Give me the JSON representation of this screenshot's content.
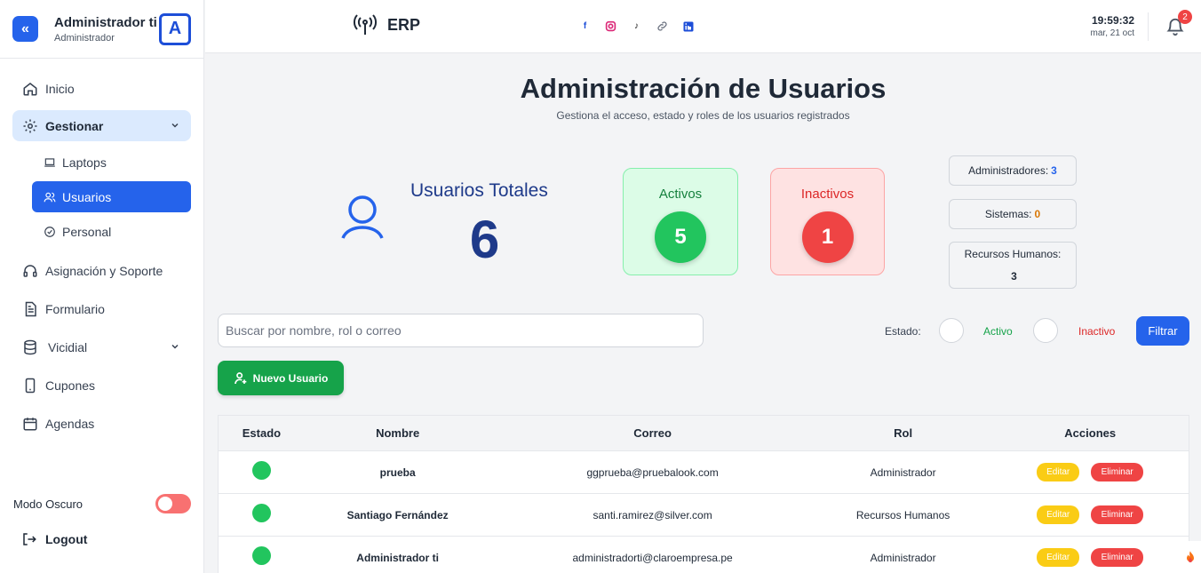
{
  "sidebar": {
    "user_name": "Administrador ti",
    "user_role": "Administrador",
    "avatar_letter": "A",
    "items": [
      {
        "label": "Inicio",
        "icon": "home-icon"
      },
      {
        "label": "Gestionar",
        "icon": "gear-icon"
      },
      {
        "label": "Asignación y Soporte",
        "icon": "headset-icon"
      },
      {
        "label": "Formulario",
        "icon": "document-icon"
      },
      {
        "label": "Vicidial",
        "icon": "database-icon"
      },
      {
        "label": "Cupones",
        "icon": "phone-icon"
      },
      {
        "label": "Agendas",
        "icon": "calendar-icon"
      }
    ],
    "sub_items": [
      {
        "label": "Laptops",
        "icon": "laptop-icon"
      },
      {
        "label": "Usuarios",
        "icon": "users-icon"
      },
      {
        "label": "Personal",
        "icon": "check-circle-icon"
      }
    ],
    "dark_mode_label": "Modo Oscuro",
    "logout_label": "Logout"
  },
  "topbar": {
    "brand": "ERP",
    "time": "19:59:32",
    "date": "mar, 21 oct",
    "notification_count": "2",
    "socials": [
      "facebook-icon",
      "instagram-icon",
      "tiktok-icon",
      "link-icon",
      "linkedin-icon"
    ]
  },
  "header": {
    "title": "Administración de Usuarios",
    "subtitle": "Gestiona el acceso, estado y roles de los usuarios registrados"
  },
  "stats": {
    "total_label": "Usuarios Totales",
    "total_value": "6",
    "activos_label": "Activos",
    "activos_value": "5",
    "inactivos_label": "Inactivos",
    "inactivos_value": "1",
    "roles": [
      {
        "label": "Administradores:",
        "value": "3"
      },
      {
        "label": "Sistemas:",
        "value": "0"
      },
      {
        "label": "Recursos Humanos:",
        "value": "3"
      }
    ]
  },
  "filters": {
    "search_placeholder": "Buscar por nombre, rol o correo",
    "estado_label": "Estado:",
    "activo_label": "Activo",
    "inactivo_label": "Inactivo",
    "filter_button": "Filtrar",
    "new_user_button": "Nuevo Usuario"
  },
  "table": {
    "headers": [
      "Estado",
      "Nombre",
      "Correo",
      "Rol",
      "Acciones"
    ],
    "edit_label": "Editar",
    "delete_label": "Eliminar",
    "rows": [
      {
        "nombre": "prueba",
        "correo": "ggprueba@pruebalook.com",
        "rol": "Administrador"
      },
      {
        "nombre": "Santiago Fernández",
        "correo": "santi.ramirez@silver.com",
        "rol": "Recursos Humanos"
      },
      {
        "nombre": "Administrador ti",
        "correo": "administradorti@claroempresa.pe",
        "rol": "Administrador"
      }
    ]
  },
  "colors": {
    "primary": "#2563eb",
    "success": "#22c55e",
    "danger": "#ef4444",
    "warning": "#facc15"
  }
}
